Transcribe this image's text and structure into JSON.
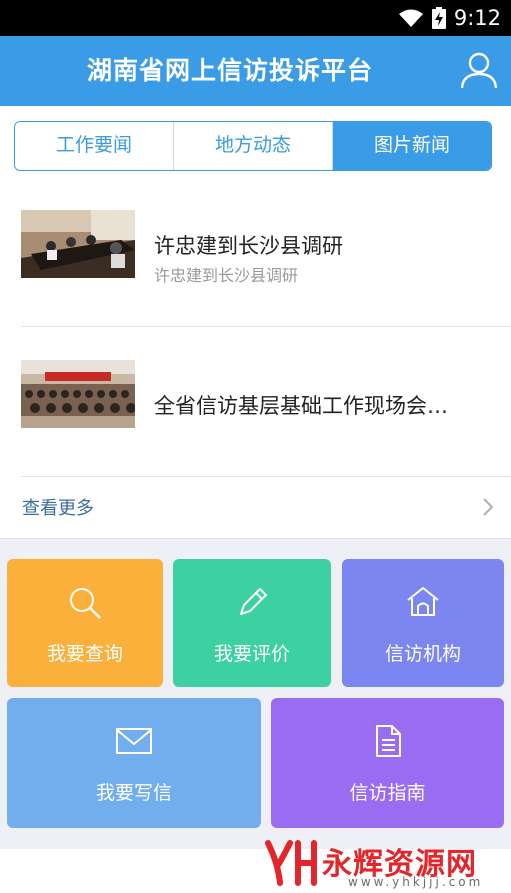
{
  "status_bar": {
    "time": "9:12"
  },
  "header": {
    "title": "湖南省网上信访投诉平台"
  },
  "tabs": [
    {
      "label": "工作要闻",
      "active": false
    },
    {
      "label": "地方动态",
      "active": false
    },
    {
      "label": "图片新闻",
      "active": true
    }
  ],
  "news": [
    {
      "headline": "许忠建到长沙县调研",
      "summary": "许忠建到长沙县调研"
    },
    {
      "headline": "全省信访基层基础工作现场会…",
      "summary": ""
    }
  ],
  "more": {
    "label": "查看更多"
  },
  "tiles": [
    {
      "label": "我要查询",
      "icon": "search-icon",
      "color": "#fbb03b"
    },
    {
      "label": "我要评价",
      "icon": "pencil-icon",
      "color": "#3dd0a1"
    },
    {
      "label": "信访机构",
      "icon": "house-icon",
      "color": "#7b86f0"
    },
    {
      "label": "我要写信",
      "icon": "envelope-icon",
      "color": "#72aeed"
    },
    {
      "label": "信访指南",
      "icon": "document-icon",
      "color": "#9a6cf2"
    }
  ],
  "watermark": {
    "text": "永辉资源网",
    "url": "www.yhkjjj.com"
  }
}
